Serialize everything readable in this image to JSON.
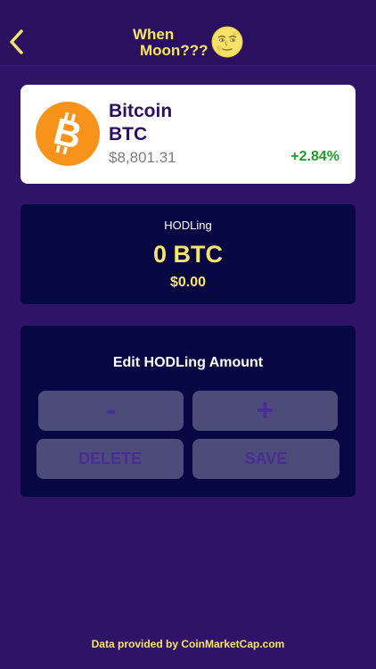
{
  "nav": {
    "back_icon": "chevron-left-icon",
    "title_line1": "When",
    "title_line2": "Moon???",
    "moon_icon": "full-moon-face-icon"
  },
  "coin": {
    "logo_icon": "bitcoin-logo-icon",
    "name": "Bitcoin",
    "symbol": "BTC",
    "price": "$8,801.31",
    "change": "+2.84%"
  },
  "holding": {
    "label": "HODLing",
    "amount": "0 BTC",
    "fiat_value": "$0.00"
  },
  "edit": {
    "title": "Edit HODLing Amount",
    "minus_label": "-",
    "plus_label": "+",
    "delete_label": "DELETE",
    "save_label": "SAVE"
  },
  "footer": {
    "text": "Data provided by CoinMarketCap.com"
  },
  "colors": {
    "background": "#2e1367",
    "accent_yellow": "#f7e46a",
    "card_dark": "#070843",
    "button": "#4c4b7a",
    "positive": "#1f9e2e"
  }
}
